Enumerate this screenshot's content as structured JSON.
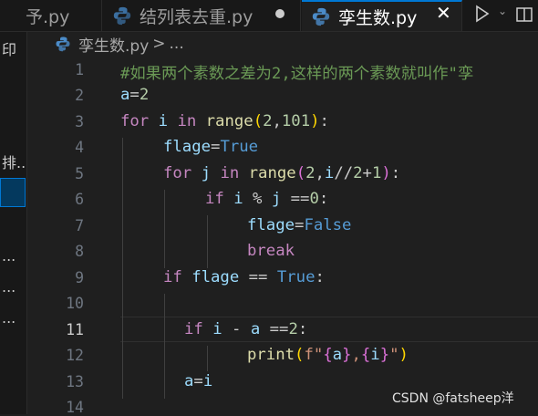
{
  "tabs": [
    {
      "label": "予.py",
      "active": false
    },
    {
      "label": "结列表去重.py",
      "active": false,
      "modified": true
    },
    {
      "label": "孪生数.py",
      "active": true
    }
  ],
  "breadcrumb": {
    "file": "孪生数.py",
    "separator": ">",
    "more": "..."
  },
  "sidebar_fragments": [
    "印",
    "排...",
    "...",
    "...",
    "..."
  ],
  "line_numbers": [
    "1",
    "2",
    "3",
    "4",
    "5",
    "6",
    "7",
    "8",
    "9",
    "10",
    "11",
    "12",
    "13",
    "14"
  ],
  "current_line": "11",
  "code_tokens": [
    [
      [
        "cm",
        "#如果两个素数之差为2,这样的两个素数就叫作\"孪"
      ]
    ],
    [
      [
        "var",
        "a"
      ],
      [
        "op",
        "="
      ],
      [
        "num",
        "2"
      ]
    ],
    [
      [
        "kw",
        "for"
      ],
      [
        "op",
        " "
      ],
      [
        "var",
        "i"
      ],
      [
        "op",
        " "
      ],
      [
        "kw",
        "in"
      ],
      [
        "op",
        " "
      ],
      [
        "fn",
        "range"
      ],
      [
        "paren",
        "("
      ],
      [
        "num",
        "2"
      ],
      [
        "op",
        ","
      ],
      [
        "num",
        "101"
      ],
      [
        "paren",
        ")"
      ],
      [
        "op",
        ":"
      ]
    ],
    [
      [
        "var",
        "flage"
      ],
      [
        "op",
        "="
      ],
      [
        "bool",
        "True"
      ]
    ],
    [
      [
        "kw",
        "for"
      ],
      [
        "op",
        " "
      ],
      [
        "var",
        "j"
      ],
      [
        "op",
        " "
      ],
      [
        "kw",
        "in"
      ],
      [
        "op",
        " "
      ],
      [
        "fn",
        "range"
      ],
      [
        "paren2",
        "("
      ],
      [
        "num",
        "2"
      ],
      [
        "op",
        ","
      ],
      [
        "var",
        "i"
      ],
      [
        "op",
        "//"
      ],
      [
        "num",
        "2"
      ],
      [
        "op",
        "+"
      ],
      [
        "num",
        "1"
      ],
      [
        "paren2",
        ")"
      ],
      [
        "op",
        ":"
      ]
    ],
    [
      [
        "kw",
        "if"
      ],
      [
        "op",
        " "
      ],
      [
        "var",
        "i"
      ],
      [
        "op",
        " % "
      ],
      [
        "var",
        "j"
      ],
      [
        "op",
        " =="
      ],
      [
        "num",
        "0"
      ],
      [
        "op",
        ":"
      ]
    ],
    [
      [
        "var",
        "flage"
      ],
      [
        "op",
        "="
      ],
      [
        "bool",
        "False"
      ]
    ],
    [
      [
        "kw",
        "break"
      ]
    ],
    [
      [
        "kw",
        "if"
      ],
      [
        "op",
        " "
      ],
      [
        "var",
        "flage"
      ],
      [
        "op",
        " == "
      ],
      [
        "bool",
        "True"
      ],
      [
        "op",
        ":"
      ]
    ],
    [],
    [
      [
        "kw",
        "if"
      ],
      [
        "op",
        " "
      ],
      [
        "var",
        "i"
      ],
      [
        "op",
        " - "
      ],
      [
        "var",
        "a"
      ],
      [
        "op",
        " =="
      ],
      [
        "num",
        "2"
      ],
      [
        "op",
        ":"
      ]
    ],
    [
      [
        "fn",
        "print"
      ],
      [
        "paren",
        "("
      ],
      [
        "str",
        "f\""
      ],
      [
        "paren2",
        "{"
      ],
      [
        "var",
        "a"
      ],
      [
        "paren2",
        "}"
      ],
      [
        "str",
        ","
      ],
      [
        "paren2",
        "{"
      ],
      [
        "var",
        "i"
      ],
      [
        "paren2",
        "}"
      ],
      [
        "str",
        "\""
      ],
      [
        "paren",
        ")"
      ]
    ],
    [
      [
        "var",
        "a"
      ],
      [
        "op",
        "="
      ],
      [
        "var",
        "i"
      ]
    ],
    []
  ],
  "watermark": "CSDN @fatsheep洋",
  "colors": {
    "editor_bg": "#1f1f1f",
    "accent": "#0078d4",
    "keyword": "#c586c0",
    "variable": "#9cdcfe",
    "function": "#dcdcaa",
    "number": "#b5cea8",
    "string": "#ce9178",
    "comment": "#6a9955",
    "boolean": "#569cd6"
  },
  "icons": [
    "python-file-icon",
    "close-icon",
    "run-icon",
    "chevron-down-icon",
    "split-editor-icon",
    "chevron-right-icon"
  ]
}
